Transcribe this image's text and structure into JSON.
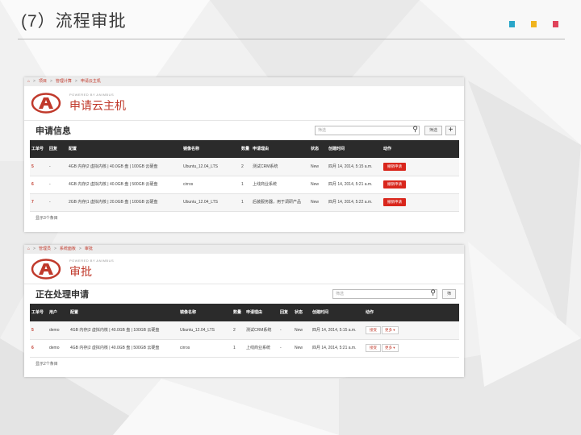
{
  "slide": {
    "title": "(7）流程审批",
    "dot_colors": [
      "#2aa6c9",
      "#f0b41f",
      "#e0435a"
    ]
  },
  "shot1": {
    "breadcrumb": [
      "项目",
      "管理计算",
      "申请云主机"
    ],
    "powered_by": "POWERED BY ANIMBUS",
    "brand_title": "申请云主机",
    "section_title": "申请信息",
    "search_placeholder": "筛选",
    "filter_label": "筛选",
    "add_label": "+",
    "columns": [
      "工单号",
      "回复",
      "配置",
      "镜像名称",
      "数量",
      "申请理由",
      "状态",
      "创建时间",
      "动作"
    ],
    "rows": [
      {
        "id": "5",
        "reply": "-",
        "config": "4GB 内存|2 虚拟内核 | 40.0GB 盘 | 100GB 云硬盘",
        "image": "Ubuntu_12.04_LTS",
        "count": "2",
        "reason": "测试CRM系统",
        "status": "New",
        "created": "四月 14, 2014, 5:15 a.m.",
        "action": "撤销申请"
      },
      {
        "id": "6",
        "reply": "-",
        "config": "4GB 内存|2 虚拟内核 | 40.0GB 盘 | 500GB 云硬盘",
        "image": "cirros",
        "count": "1",
        "reason": "上线商业系统",
        "status": "New",
        "created": "四月 14, 2014, 5:21 a.m.",
        "action": "撤销申请"
      },
      {
        "id": "7",
        "reply": "-",
        "config": "2GB 内存|1 虚拟内核 | 20.0GB 盘 | 100GB 云硬盘",
        "image": "Ubuntu_12.04_LTS",
        "count": "1",
        "reason": "后装服务器，用于调研产品",
        "status": "New",
        "created": "四月 14, 2014, 5:22 a.m.",
        "action": "撤销申请"
      }
    ],
    "footer": "显示3个条目"
  },
  "shot2": {
    "breadcrumb": [
      "管理员",
      "系统面板",
      "审批"
    ],
    "powered_by": "POWERED BY ANIMBUS",
    "brand_title": "审批",
    "section_title": "正在处理申请",
    "search_placeholder": "筛选",
    "filter_label": "筛",
    "columns": [
      "工单号",
      "用户",
      "配置",
      "镜像名称",
      "数量",
      "申请理由",
      "回复",
      "状态",
      "创建时间",
      "动作"
    ],
    "rows": [
      {
        "id": "5",
        "user": "demo",
        "config": "4GB 内存|2 虚拟内核 | 40.0GB 盘 | 100GB 云硬盘",
        "image": "Ubuntu_12.04_LTS",
        "count": "2",
        "reason": "测试CRM系统",
        "reply": "-",
        "status": "New",
        "created": "四月 14, 2014, 5:15 a.m.",
        "approve": "接受",
        "more": "更多 ▾"
      },
      {
        "id": "6",
        "user": "demo",
        "config": "4GB 内存|2 虚拟内核 | 40.0GB 盘 | 500GB 云硬盘",
        "image": "cirros",
        "count": "1",
        "reason": "上线商业系统",
        "reply": "-",
        "status": "New",
        "created": "四月 14, 2014, 5:21 a.m.",
        "approve": "接受",
        "more": "更多 ▾"
      }
    ],
    "footer": "显示2个条目"
  }
}
